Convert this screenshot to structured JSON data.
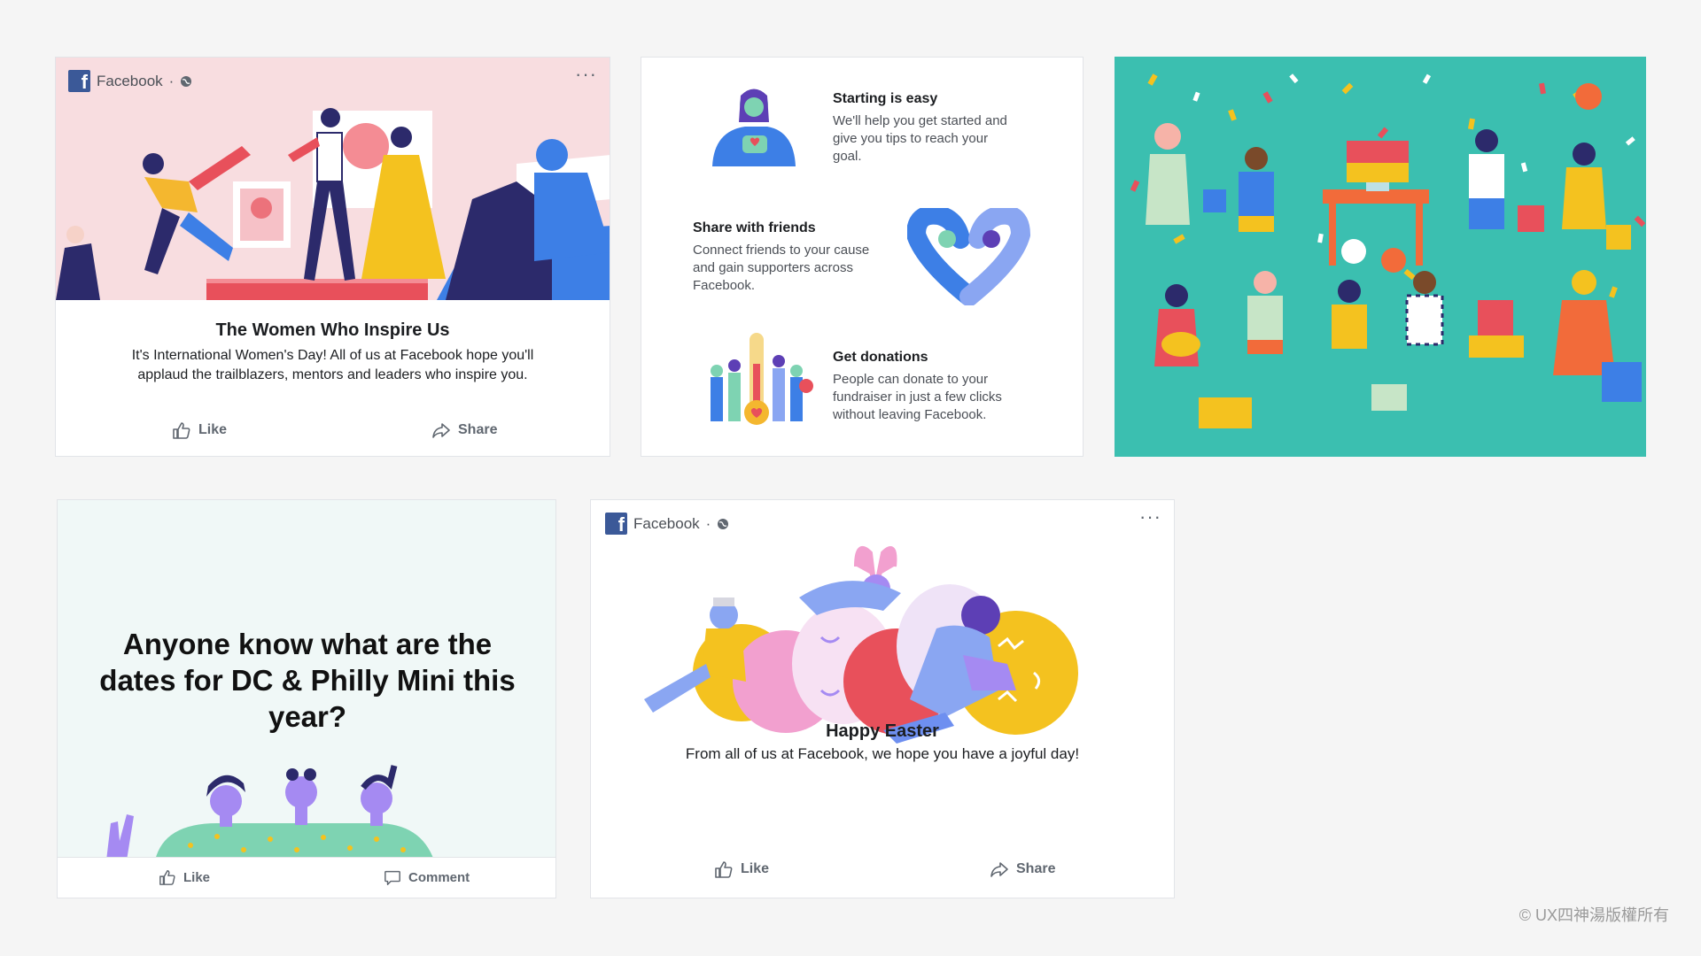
{
  "cards": {
    "wwd": {
      "page_name": "Facebook",
      "separator": "·",
      "title": "The Women Who Inspire Us",
      "text_line1": "It's International Women's Day! All of us at Facebook hope you'll",
      "text_line2": "applaud the trailblazers, mentors and leaders who inspire you.",
      "like_label": "Like",
      "share_label": "Share"
    },
    "fundraiser": {
      "steps": [
        {
          "title": "Starting is easy",
          "lines": [
            "We'll help you get started and",
            "give you tips to reach your",
            "goal."
          ]
        },
        {
          "title": "Share with friends",
          "lines": [
            "Connect friends to your cause",
            "and gain supporters across",
            "Facebook."
          ]
        },
        {
          "title": "Get donations",
          "lines": [
            "People can donate to your",
            "fundraiser in just a few clicks",
            "without leaving Facebook."
          ]
        }
      ]
    },
    "question": {
      "line1": "Anyone know what are the",
      "line2": "dates for DC & Philly Mini this",
      "line3": "year?",
      "like_label": "Like",
      "comment_label": "Comment"
    },
    "easter": {
      "page_name": "Facebook",
      "separator": "·",
      "title": "Happy Easter",
      "text": "From all of us at Facebook, we hope you have a joyful day!",
      "like_label": "Like",
      "share_label": "Share"
    }
  },
  "watermark": "© UX四神湯版權所有",
  "colors": {
    "facebook_blue": "#3b5998",
    "party_teal": "#3bbfb0",
    "wwd_pink": "#f8dde0",
    "question_mint": "#f0f8f7"
  }
}
